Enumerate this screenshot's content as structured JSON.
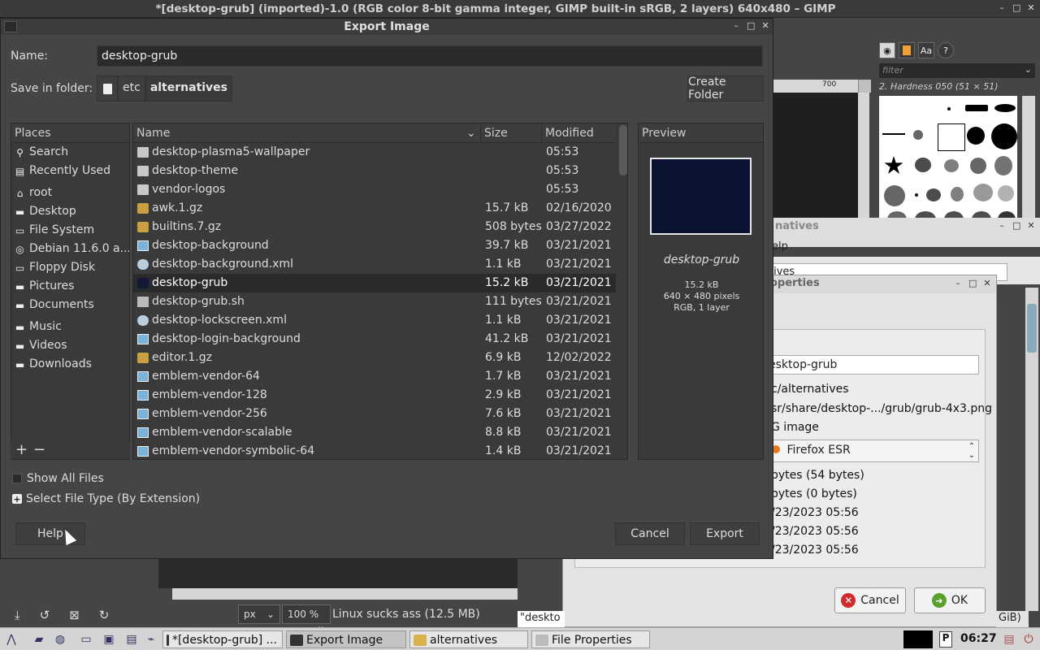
{
  "gimp_window": {
    "title": "*[desktop-grub] (imported)-1.0 (RGB color 8-bit gamma integer, GIMP built-in sRGB, 2 layers) 640x480 – GIMP",
    "ruler_tick": "700",
    "status_unit": "px",
    "status_zoom": "100 %",
    "status_text": "Linux sucks ass (12.5 MB)",
    "bottom_desk_text": "\"deskto"
  },
  "brushes_dock": {
    "filter_placeholder": "filter",
    "brush_name": "2. Hardness 050 (51 × 51)",
    "tabs": [
      "brushes",
      "patterns",
      "fonts",
      "help"
    ]
  },
  "alternatives_window": {
    "title": "natives",
    "menu": "elp",
    "path": "tives"
  },
  "file_properties": {
    "title": "operties",
    "name_value": "esktop-grub",
    "location": "c/alternatives",
    "target": "sr/share/desktop-.../grub/grub-4x3.png",
    "type": "G image",
    "open_with": "Firefox ESR",
    "size": " bytes (54 bytes)",
    "size_on_disk": "bytes (0 bytes)",
    "dates": [
      "/23/2023 05:56",
      "/23/2023 05:56",
      "/23/2023 05:56"
    ],
    "cancel_label": "Cancel",
    "ok_label": "OK",
    "gib_text": "GiB)"
  },
  "export_dialog": {
    "title": "Export Image",
    "name_label": "Name:",
    "name_value": "desktop-grub",
    "folder_label": "Save in folder:",
    "crumbs": [
      "etc",
      "alternatives"
    ],
    "create_folder": "Create Folder",
    "places_header": "Places",
    "places": [
      {
        "label": "Search",
        "icon": "search-icon"
      },
      {
        "label": "Recently Used",
        "icon": "recent-icon"
      },
      {
        "label": "root",
        "icon": "home-icon"
      },
      {
        "label": "Desktop",
        "icon": "folder-icon"
      },
      {
        "label": "File System",
        "icon": "drive-icon"
      },
      {
        "label": "Debian 11.6.0 a...",
        "icon": "disc-icon"
      },
      {
        "label": "Floppy Disk",
        "icon": "floppy-icon"
      },
      {
        "label": "Pictures",
        "icon": "folder-icon"
      },
      {
        "label": "Documents",
        "icon": "folder-icon"
      },
      {
        "label": "Music",
        "icon": "folder-icon"
      },
      {
        "label": "Videos",
        "icon": "folder-icon"
      },
      {
        "label": "Downloads",
        "icon": "folder-icon"
      }
    ],
    "columns": {
      "name": "Name",
      "size": "Size",
      "modified": "Modified"
    },
    "files": [
      {
        "name": "desktop-plasma5-wallpaper",
        "size": "",
        "modified": "05:53",
        "icon": "folder"
      },
      {
        "name": "desktop-theme",
        "size": "",
        "modified": "05:53",
        "icon": "folder"
      },
      {
        "name": "vendor-logos",
        "size": "",
        "modified": "05:53",
        "icon": "folder"
      },
      {
        "name": "awk.1.gz",
        "size": "15.7 kB",
        "modified": "02/16/2020",
        "icon": "gz"
      },
      {
        "name": "builtins.7.gz",
        "size": "508 bytes",
        "modified": "03/27/2022",
        "icon": "gz"
      },
      {
        "name": "desktop-background",
        "size": "39.7 kB",
        "modified": "03/21/2021",
        "icon": "img"
      },
      {
        "name": "desktop-background.xml",
        "size": "1.1 kB",
        "modified": "03/21/2021",
        "icon": "xml"
      },
      {
        "name": "desktop-grub",
        "size": "15.2 kB",
        "modified": "03/21/2021",
        "icon": "dark"
      },
      {
        "name": "desktop-grub.sh",
        "size": "111 bytes",
        "modified": "03/21/2021",
        "icon": "sh"
      },
      {
        "name": "desktop-lockscreen.xml",
        "size": "1.1 kB",
        "modified": "03/21/2021",
        "icon": "xml"
      },
      {
        "name": "desktop-login-background",
        "size": "41.2 kB",
        "modified": "03/21/2021",
        "icon": "img"
      },
      {
        "name": "editor.1.gz",
        "size": "6.9 kB",
        "modified": "12/02/2022",
        "icon": "gz"
      },
      {
        "name": "emblem-vendor-64",
        "size": "1.7 kB",
        "modified": "03/21/2021",
        "icon": "img"
      },
      {
        "name": "emblem-vendor-128",
        "size": "2.9 kB",
        "modified": "03/21/2021",
        "icon": "img"
      },
      {
        "name": "emblem-vendor-256",
        "size": "7.6 kB",
        "modified": "03/21/2021",
        "icon": "img"
      },
      {
        "name": "emblem-vendor-scalable",
        "size": "8.8 kB",
        "modified": "03/21/2021",
        "icon": "img"
      },
      {
        "name": "emblem-vendor-symbolic-64",
        "size": "1.4 kB",
        "modified": "03/21/2021",
        "icon": "img"
      }
    ],
    "preview_header": "Preview",
    "preview_name": "desktop-grub",
    "preview_size": "15.2 kB",
    "preview_dims": "640 × 480 pixels",
    "preview_mode": "RGB, 1 layer",
    "show_all_files": "Show All Files",
    "select_file_type": "Select File Type (By Extension)",
    "help_label": "Help",
    "cancel_label": "Cancel",
    "export_label": "Export"
  },
  "taskbar": {
    "tasks": [
      "*[desktop-grub] ...",
      "Export Image",
      "alternatives",
      "File Properties"
    ],
    "clock": "06:27",
    "tray_p": "P"
  }
}
